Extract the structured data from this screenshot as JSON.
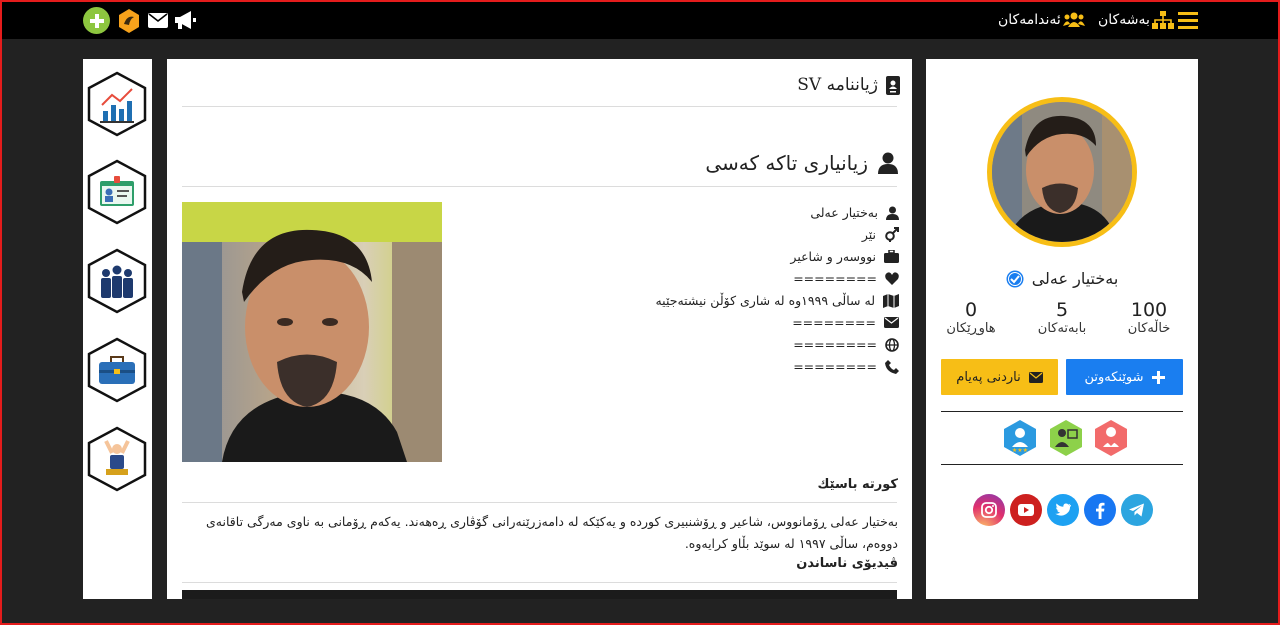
{
  "topbar": {
    "members_label": "ئەندامەکان",
    "sections_label": "بەشەکان",
    "icons": [
      "add-icon",
      "medal-icon",
      "envelope-icon",
      "megaphone-icon",
      "users-icon",
      "sitemap-icon",
      "menu-icon"
    ]
  },
  "main": {
    "page_title": "ژیاننامە SV",
    "section_title": "زیانیاری تاکە کەسی",
    "info": {
      "name": "بەختیار عەلی",
      "gender": "نێر",
      "job": "نووسەر و شاعیر",
      "relationship": "========",
      "residence": "لە ساڵی ١٩٩٩وە لە شاری کۆڵن نیشتەجێیە",
      "email": "========",
      "website": "========",
      "phone": "========"
    },
    "bio_title": "کورتە باسێك",
    "bio_text": "بەختیار عەلی ڕۆمانووس، شاعیر و ڕۆشنبیری کوردە و یەکێکە لە دامەزرێنەرانی گۆڤاری ڕەهەند. یەکەم ڕۆمانی بە ناوی مەرگی تاقانەی دووەم، ساڵی ١٩٩٧ لە سوێد بڵاو کرایەوە.",
    "video_title": "ڤیدیۆی ناساندن"
  },
  "profile": {
    "name": "بەختیار عەلی",
    "stats": [
      {
        "value": "100",
        "label": "خاڵەکان"
      },
      {
        "value": "5",
        "label": "بابەتەکان"
      },
      {
        "value": "0",
        "label": "هاوڕێکان"
      }
    ],
    "follow_label": "شوێنکەوتن",
    "message_label": "ناردنی پەیام",
    "colors": {
      "follow": "#1a7ef0",
      "message": "#f7be16",
      "ring": "#f7be16"
    }
  },
  "left_menu": [
    "chart-icon",
    "id-card-icon",
    "team-icon",
    "briefcase-icon",
    "winner-icon"
  ],
  "social": [
    "instagram-icon",
    "youtube-icon",
    "twitter-icon",
    "facebook-icon",
    "telegram-icon"
  ]
}
